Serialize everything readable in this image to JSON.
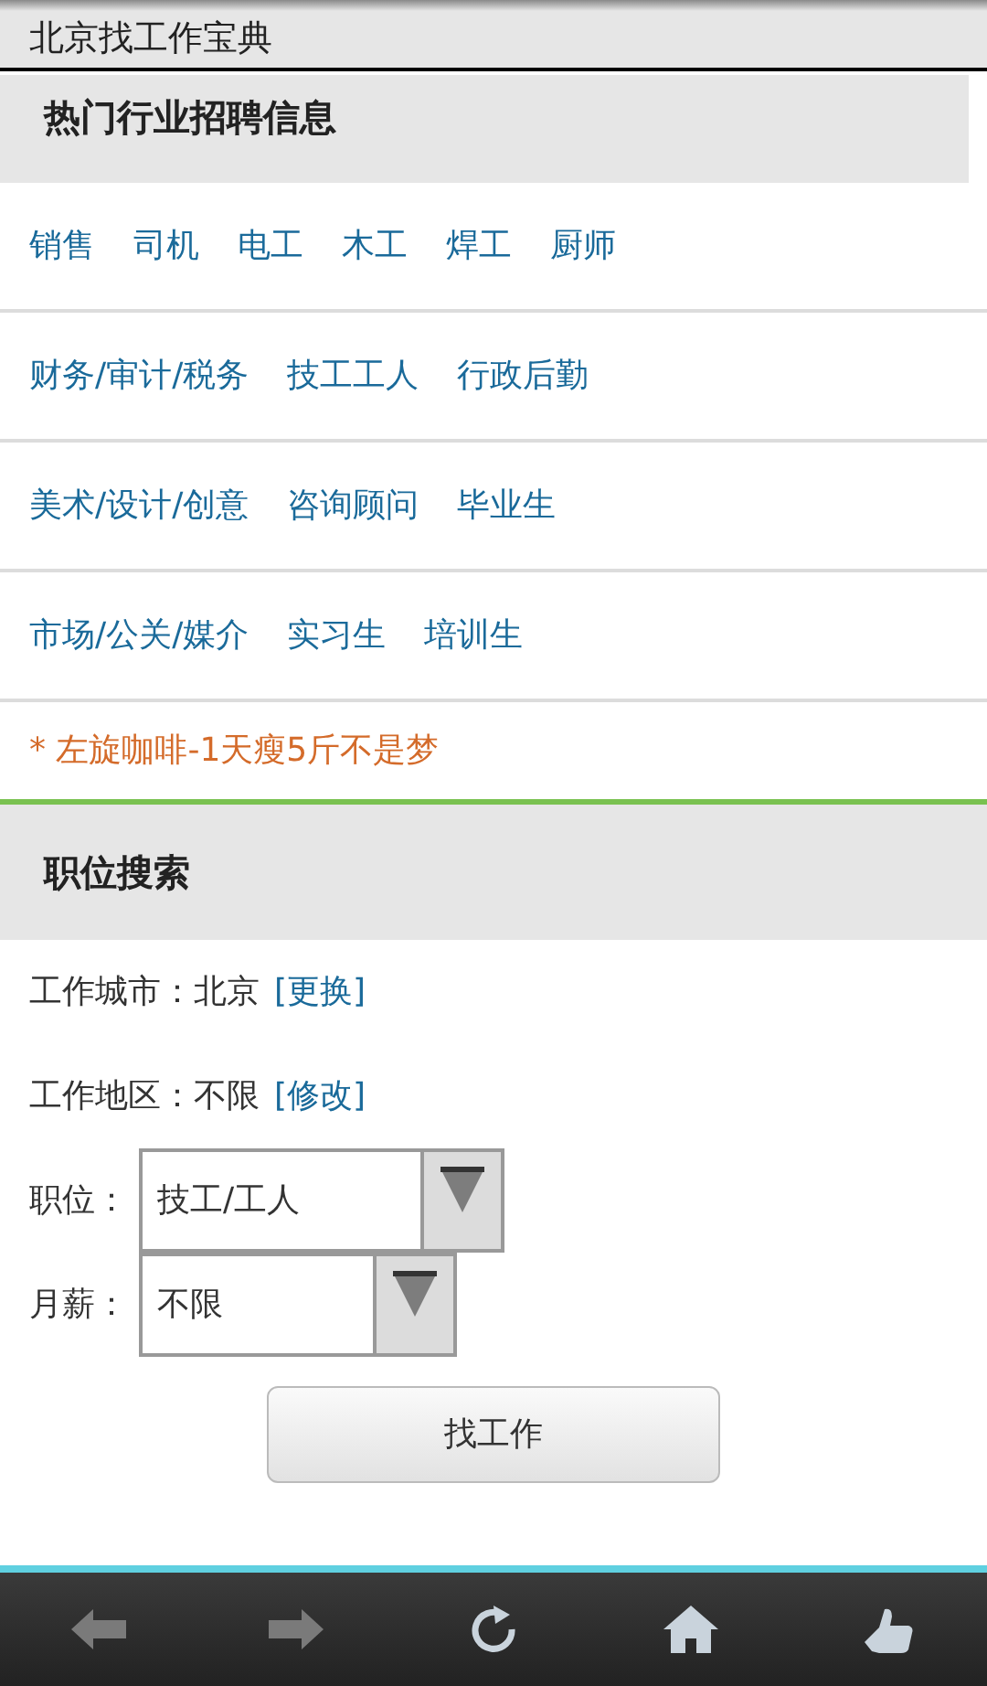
{
  "header": {
    "title": "北京找工作宝典"
  },
  "hot_industries": {
    "heading": "热门行业招聘信息",
    "link_groups": [
      {
        "links": [
          "销售",
          "司机",
          "电工",
          "木工",
          "焊工",
          "厨师"
        ]
      },
      {
        "links": [
          "财务/审计/税务",
          "技工工人",
          "行政后勤"
        ]
      },
      {
        "links": [
          "美术/设计/创意",
          "咨询顾问",
          "毕业生"
        ]
      },
      {
        "links": [
          "市场/公关/媒介",
          "实习生",
          "培训生"
        ]
      }
    ],
    "ad": "* 左旋咖啡-1天瘦5斤不是梦"
  },
  "job_search": {
    "heading": "职位搜索",
    "city": {
      "label": "工作城市：北京",
      "link": "[更换]"
    },
    "area": {
      "label": "工作地区：不限",
      "link": "[修改]"
    },
    "selects": [
      {
        "label": "职位：",
        "value": "技工/工人"
      },
      {
        "label": "月薪：",
        "value": "不限"
      }
    ],
    "submit": "找工作"
  },
  "toolbar": [
    {
      "kind": "back",
      "disabled": true
    },
    {
      "kind": "forward",
      "disabled": true
    },
    {
      "kind": "reload",
      "disabled": false
    },
    {
      "kind": "home",
      "disabled": false
    },
    {
      "kind": "like",
      "disabled": false
    }
  ]
}
